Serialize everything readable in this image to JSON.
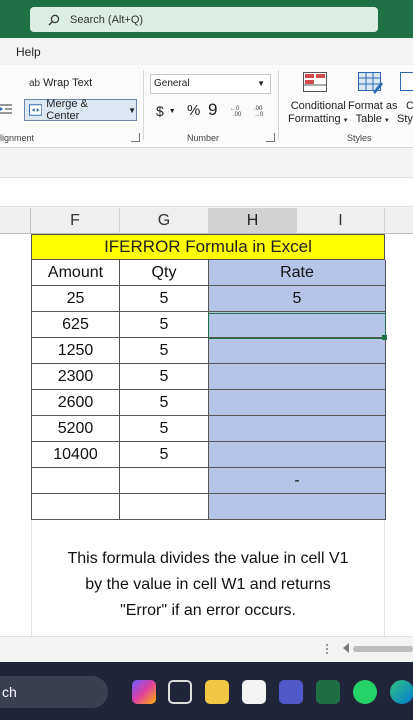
{
  "titlebar": {
    "search_placeholder": "Search (Alt+Q)"
  },
  "menu": {
    "help": "Help"
  },
  "ribbon": {
    "alignment": {
      "wrap_text": "Wrap Text",
      "merge_center": "Merge & Center",
      "label": "lignment"
    },
    "number": {
      "format_value": "General",
      "currency": "$",
      "percent": "%",
      "comma": "9",
      "label": "Number"
    },
    "styles": {
      "conditional_line1": "Conditional",
      "conditional_line2": "Formatting",
      "format_table_line1": "Format as",
      "format_table_line2": "Table",
      "cell_styles_line1": "C",
      "cell_styles_line2": "Styl",
      "label": "Styles"
    }
  },
  "sheet": {
    "columns": [
      "F",
      "G",
      "H",
      "I"
    ],
    "title": "IFERROR Formula in Excel",
    "headers": {
      "amount": "Amount",
      "qty": "Qty",
      "rate": "Rate"
    },
    "rows": [
      {
        "amount": "25",
        "qty": "5",
        "rate": "5"
      },
      {
        "amount": "625",
        "qty": "5",
        "rate": ""
      },
      {
        "amount": "1250",
        "qty": "5",
        "rate": ""
      },
      {
        "amount": "2300",
        "qty": "5",
        "rate": ""
      },
      {
        "amount": "2600",
        "qty": "5",
        "rate": ""
      },
      {
        "amount": "5200",
        "qty": "5",
        "rate": ""
      },
      {
        "amount": "10400",
        "qty": "5",
        "rate": ""
      },
      {
        "amount": "",
        "qty": "",
        "rate": "-"
      },
      {
        "amount": "",
        "qty": "",
        "rate": ""
      }
    ],
    "caption": [
      "This formula divides the value in cell V1",
      "by the value in cell W1 and returns",
      "\"Error\" if an error occurs."
    ]
  },
  "taskbar": {
    "search_text": "ch"
  },
  "colors": {
    "excel_green": "#1e7145",
    "title_yellow": "#ffff00",
    "rate_blue": "#b4c5e7",
    "taskbar": "#20253a"
  }
}
